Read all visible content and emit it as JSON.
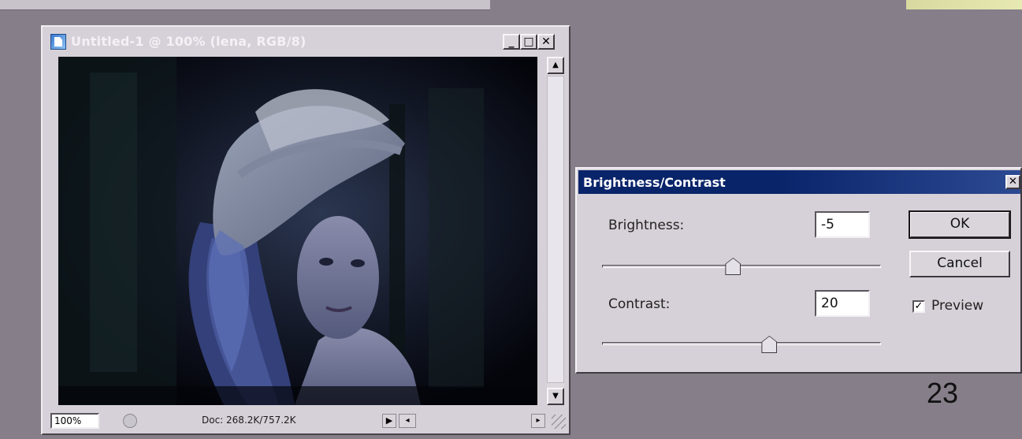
{
  "document_window": {
    "title": "Untitled-1 @ 100% (lena, RGB/8)",
    "controls": {
      "minimize": "_",
      "maximize": "□",
      "close": "✕"
    },
    "image_alt": "lena",
    "status": {
      "zoom": "100%",
      "doc_info": "Doc: 268.2K/757.2K",
      "arrow": "▶"
    },
    "scroll_up": "▲",
    "scroll_down": "▼"
  },
  "dialog": {
    "title": "Brightness/Contrast",
    "close": "✕",
    "brightness": {
      "label": "Brightness:",
      "value": "-5",
      "slider_fraction": 0.47
    },
    "contrast": {
      "label": "Contrast:",
      "value": "20",
      "slider_fraction": 0.6
    },
    "buttons": {
      "ok": "OK",
      "cancel": "Cancel"
    },
    "preview": {
      "label": "Preview",
      "checked": true,
      "mark": "✓"
    }
  },
  "slide_number": "23",
  "colors": {
    "desktop": "#867e89",
    "title_active": "#0a246a",
    "chrome": "#d6d1d8"
  }
}
